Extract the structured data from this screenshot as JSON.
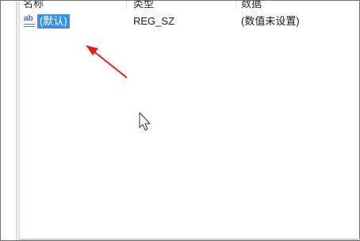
{
  "columns": {
    "name": "名称",
    "type": "类型",
    "data": "数据"
  },
  "rows": [
    {
      "icon": "string-value-icon",
      "icon_text": "ab",
      "name": "(默认)",
      "type": "REG_SZ",
      "data": "(数值未设置)",
      "selected": true
    }
  ],
  "colors": {
    "selection": "#3c8fe6",
    "arrow": "#e32020"
  }
}
